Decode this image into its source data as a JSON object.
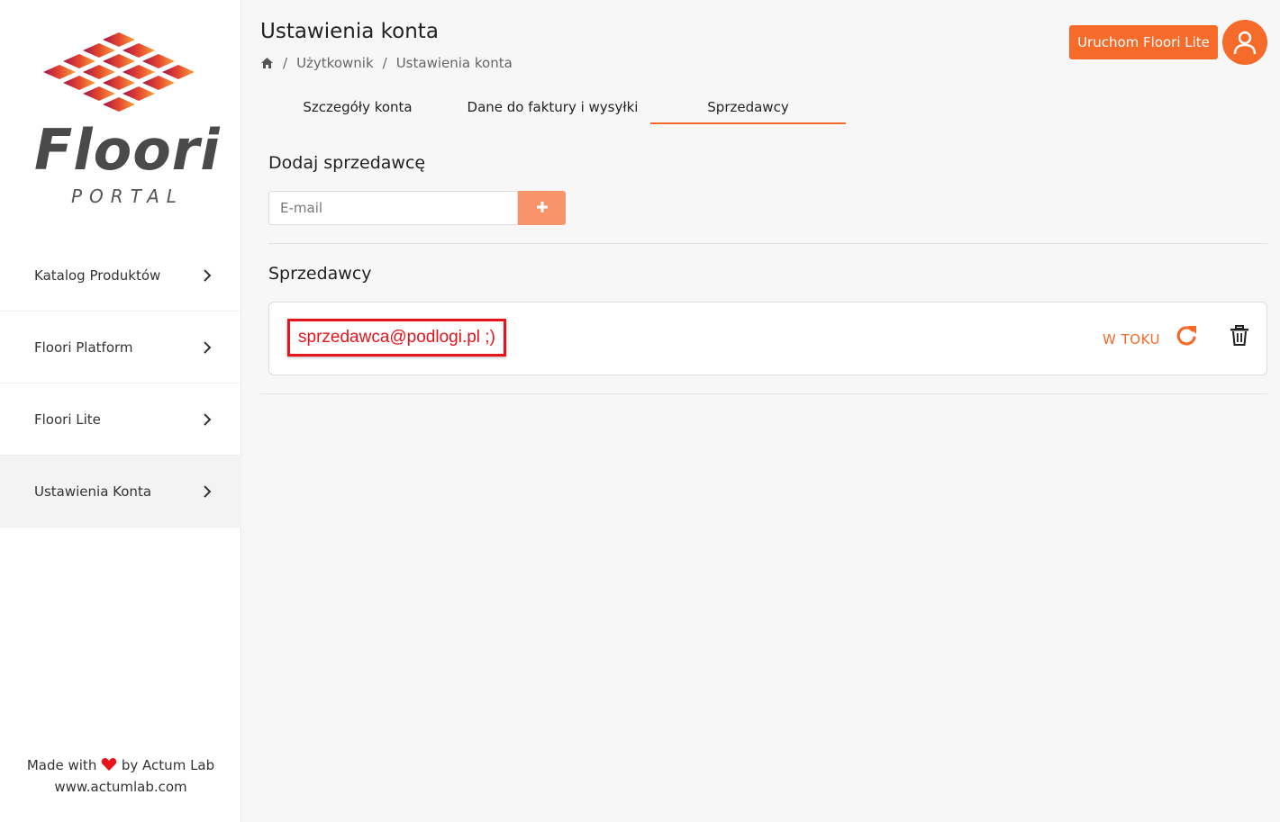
{
  "brand": {
    "name": "Floori",
    "subtitle": "PORTAL",
    "accent_color": "#f66a2a"
  },
  "sidebar": {
    "items": [
      {
        "label": "Katalog Produktów",
        "icon": "chevron-right-icon",
        "active": false
      },
      {
        "label": "Floori Platform",
        "icon": "chevron-right-icon",
        "active": false
      },
      {
        "label": "Floori Lite",
        "icon": "chevron-right-icon",
        "active": false
      },
      {
        "label": "Ustawienia Konta",
        "icon": "chevron-right-icon",
        "active": true
      }
    ],
    "footer": {
      "made_with": "Made with",
      "by": "by Actum Lab",
      "website": "www.actumlab.com"
    }
  },
  "header": {
    "title": "Ustawienia konta",
    "breadcrumb": [
      "Użytkownik",
      "Ustawienia konta"
    ],
    "launch_button": "Uruchom Floori Lite"
  },
  "tabs": [
    {
      "label": "Szczegóły konta",
      "active": false
    },
    {
      "label": "Dane do faktury i wysyłki",
      "active": false
    },
    {
      "label": "Sprzedawcy",
      "active": true
    }
  ],
  "add_seller": {
    "title": "Dodaj sprzedawcę",
    "input_placeholder": "E-mail",
    "input_value": "",
    "button_icon": "plus-icon"
  },
  "sellers": {
    "title": "Sprzedawcy",
    "items": [
      {
        "email": "sprzedawca@podlogi.pl ;)",
        "status": "W TOKU"
      }
    ]
  }
}
